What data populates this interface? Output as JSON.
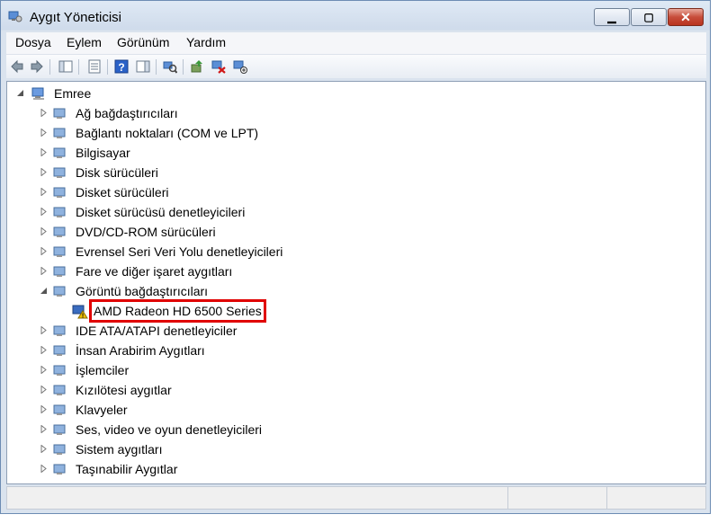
{
  "window": {
    "title": "Aygıt Yöneticisi",
    "min_label": "▭",
    "max_label": "▢",
    "close_label": "✕"
  },
  "menu": [
    "Dosya",
    "Eylem",
    "Görünüm",
    "Yardım"
  ],
  "tree": {
    "root": "Emree",
    "categories": [
      "Ağ bağdaştırıcıları",
      "Bağlantı noktaları (COM ve LPT)",
      "Bilgisayar",
      "Disk sürücüleri",
      "Disket sürücüleri",
      "Disket sürücüsü denetleyicileri",
      "DVD/CD-ROM sürücüleri",
      "Evrensel Seri Veri Yolu denetleyicileri",
      "Fare ve diğer işaret aygıtları",
      "Görüntü bağdaştırıcıları",
      "IDE ATA/ATAPI denetleyiciler",
      "İnsan Arabirim Aygıtları",
      "İşlemciler",
      "Kızılötesi aygıtlar",
      "Klavyeler",
      "Ses, video ve oyun denetleyicileri",
      "Sistem aygıtları",
      "Taşınabilir Aygıtlar"
    ],
    "display_child": "AMD Radeon HD 6500 Series"
  },
  "colors": {
    "highlight_box": "#e00000",
    "border": "#8e9fb6"
  }
}
